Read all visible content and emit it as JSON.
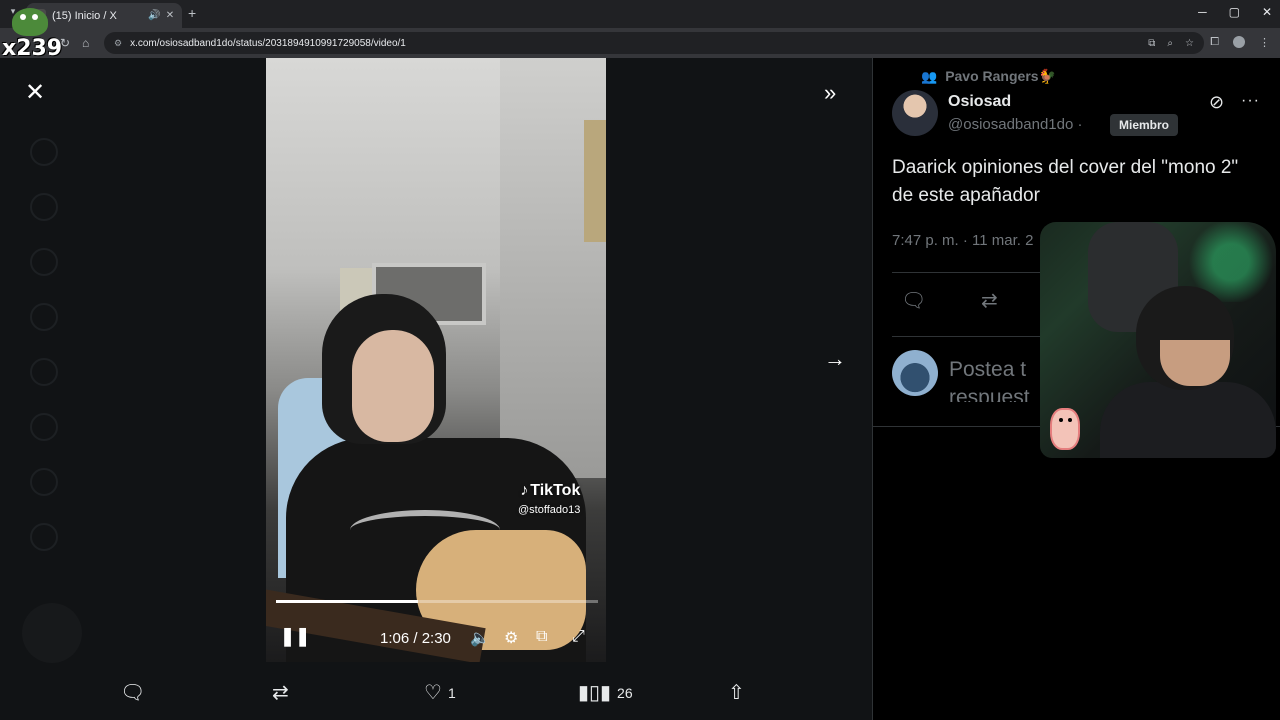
{
  "browser": {
    "tab_title": "(15) Inicio / X",
    "url": "x.com/osiosadband1do/status/2031894910991729058/video/1",
    "overlay_logo_text": "x239"
  },
  "video": {
    "watermark_brand": "TikTok",
    "watermark_handle": "@stoffado13",
    "time_display": "1:06 / 2:30",
    "progress_fraction": 0.44
  },
  "actions": {
    "likes": "1",
    "views": "26"
  },
  "post": {
    "community": "Pavo Rangers🐓",
    "author_name": "Osiosad",
    "author_handle": "@osiosadband1do ·",
    "badge": "Miembro",
    "text": "Daarick opiniones del cover del \"mono 2\" de este apañador",
    "time": "7:47 p. m. · 11 mar. 2",
    "reply_placeholder_line1": "Postea t",
    "reply_placeholder_line2": "respuest"
  }
}
